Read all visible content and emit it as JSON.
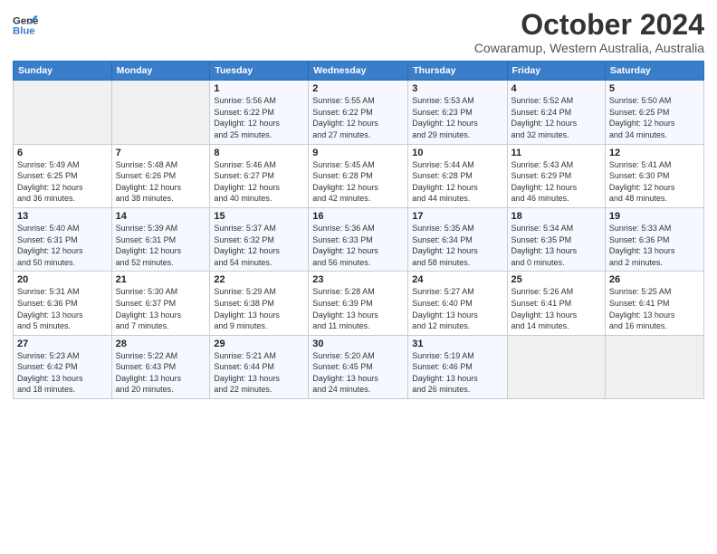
{
  "header": {
    "logo_line1": "General",
    "logo_line2": "Blue",
    "month": "October 2024",
    "location": "Cowaramup, Western Australia, Australia"
  },
  "weekdays": [
    "Sunday",
    "Monday",
    "Tuesday",
    "Wednesday",
    "Thursday",
    "Friday",
    "Saturday"
  ],
  "weeks": [
    [
      {
        "day": "",
        "info": ""
      },
      {
        "day": "",
        "info": ""
      },
      {
        "day": "1",
        "info": "Sunrise: 5:56 AM\nSunset: 6:22 PM\nDaylight: 12 hours\nand 25 minutes."
      },
      {
        "day": "2",
        "info": "Sunrise: 5:55 AM\nSunset: 6:22 PM\nDaylight: 12 hours\nand 27 minutes."
      },
      {
        "day": "3",
        "info": "Sunrise: 5:53 AM\nSunset: 6:23 PM\nDaylight: 12 hours\nand 29 minutes."
      },
      {
        "day": "4",
        "info": "Sunrise: 5:52 AM\nSunset: 6:24 PM\nDaylight: 12 hours\nand 32 minutes."
      },
      {
        "day": "5",
        "info": "Sunrise: 5:50 AM\nSunset: 6:25 PM\nDaylight: 12 hours\nand 34 minutes."
      }
    ],
    [
      {
        "day": "6",
        "info": "Sunrise: 5:49 AM\nSunset: 6:25 PM\nDaylight: 12 hours\nand 36 minutes."
      },
      {
        "day": "7",
        "info": "Sunrise: 5:48 AM\nSunset: 6:26 PM\nDaylight: 12 hours\nand 38 minutes."
      },
      {
        "day": "8",
        "info": "Sunrise: 5:46 AM\nSunset: 6:27 PM\nDaylight: 12 hours\nand 40 minutes."
      },
      {
        "day": "9",
        "info": "Sunrise: 5:45 AM\nSunset: 6:28 PM\nDaylight: 12 hours\nand 42 minutes."
      },
      {
        "day": "10",
        "info": "Sunrise: 5:44 AM\nSunset: 6:28 PM\nDaylight: 12 hours\nand 44 minutes."
      },
      {
        "day": "11",
        "info": "Sunrise: 5:43 AM\nSunset: 6:29 PM\nDaylight: 12 hours\nand 46 minutes."
      },
      {
        "day": "12",
        "info": "Sunrise: 5:41 AM\nSunset: 6:30 PM\nDaylight: 12 hours\nand 48 minutes."
      }
    ],
    [
      {
        "day": "13",
        "info": "Sunrise: 5:40 AM\nSunset: 6:31 PM\nDaylight: 12 hours\nand 50 minutes."
      },
      {
        "day": "14",
        "info": "Sunrise: 5:39 AM\nSunset: 6:31 PM\nDaylight: 12 hours\nand 52 minutes."
      },
      {
        "day": "15",
        "info": "Sunrise: 5:37 AM\nSunset: 6:32 PM\nDaylight: 12 hours\nand 54 minutes."
      },
      {
        "day": "16",
        "info": "Sunrise: 5:36 AM\nSunset: 6:33 PM\nDaylight: 12 hours\nand 56 minutes."
      },
      {
        "day": "17",
        "info": "Sunrise: 5:35 AM\nSunset: 6:34 PM\nDaylight: 12 hours\nand 58 minutes."
      },
      {
        "day": "18",
        "info": "Sunrise: 5:34 AM\nSunset: 6:35 PM\nDaylight: 13 hours\nand 0 minutes."
      },
      {
        "day": "19",
        "info": "Sunrise: 5:33 AM\nSunset: 6:36 PM\nDaylight: 13 hours\nand 2 minutes."
      }
    ],
    [
      {
        "day": "20",
        "info": "Sunrise: 5:31 AM\nSunset: 6:36 PM\nDaylight: 13 hours\nand 5 minutes."
      },
      {
        "day": "21",
        "info": "Sunrise: 5:30 AM\nSunset: 6:37 PM\nDaylight: 13 hours\nand 7 minutes."
      },
      {
        "day": "22",
        "info": "Sunrise: 5:29 AM\nSunset: 6:38 PM\nDaylight: 13 hours\nand 9 minutes."
      },
      {
        "day": "23",
        "info": "Sunrise: 5:28 AM\nSunset: 6:39 PM\nDaylight: 13 hours\nand 11 minutes."
      },
      {
        "day": "24",
        "info": "Sunrise: 5:27 AM\nSunset: 6:40 PM\nDaylight: 13 hours\nand 12 minutes."
      },
      {
        "day": "25",
        "info": "Sunrise: 5:26 AM\nSunset: 6:41 PM\nDaylight: 13 hours\nand 14 minutes."
      },
      {
        "day": "26",
        "info": "Sunrise: 5:25 AM\nSunset: 6:41 PM\nDaylight: 13 hours\nand 16 minutes."
      }
    ],
    [
      {
        "day": "27",
        "info": "Sunrise: 5:23 AM\nSunset: 6:42 PM\nDaylight: 13 hours\nand 18 minutes."
      },
      {
        "day": "28",
        "info": "Sunrise: 5:22 AM\nSunset: 6:43 PM\nDaylight: 13 hours\nand 20 minutes."
      },
      {
        "day": "29",
        "info": "Sunrise: 5:21 AM\nSunset: 6:44 PM\nDaylight: 13 hours\nand 22 minutes."
      },
      {
        "day": "30",
        "info": "Sunrise: 5:20 AM\nSunset: 6:45 PM\nDaylight: 13 hours\nand 24 minutes."
      },
      {
        "day": "31",
        "info": "Sunrise: 5:19 AM\nSunset: 6:46 PM\nDaylight: 13 hours\nand 26 minutes."
      },
      {
        "day": "",
        "info": ""
      },
      {
        "day": "",
        "info": ""
      }
    ]
  ]
}
